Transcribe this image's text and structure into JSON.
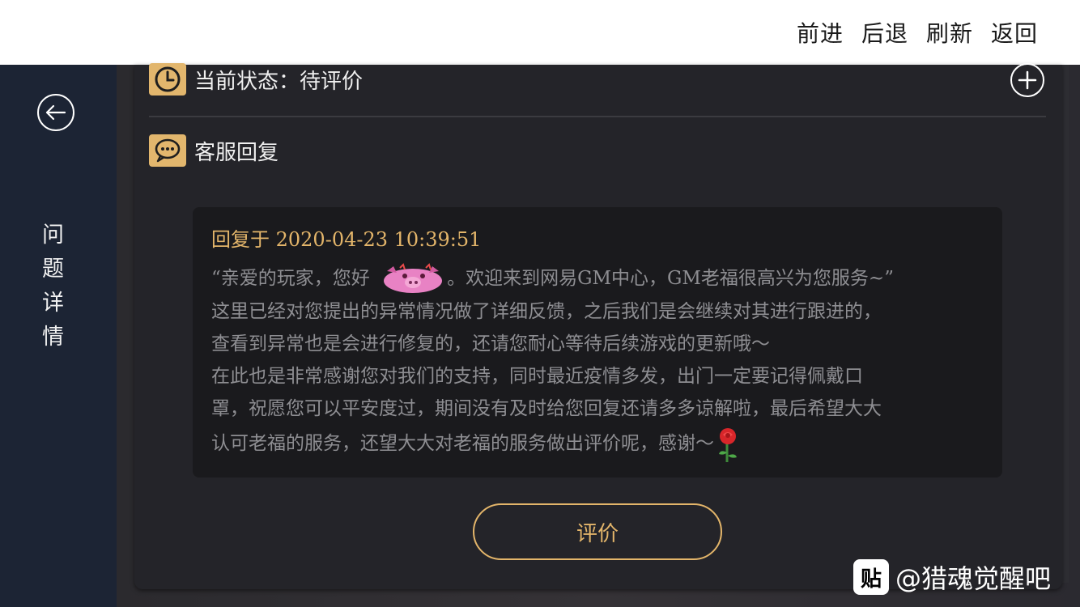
{
  "topbar": {
    "forward": "前进",
    "back": "后退",
    "refresh": "刷新",
    "return": "返回"
  },
  "sidebar": {
    "title_chars": [
      "问",
      "题",
      "详",
      "情"
    ]
  },
  "status": {
    "label": "当前状态：待评价"
  },
  "reply_section": {
    "label": "客服回复",
    "header": "回复于 2020-04-23 10:39:51",
    "line1_a": "“亲爱的玩家，您好",
    "line1_b": "。欢迎来到网易GM中心，GM老福很高兴为您服务~”",
    "line2": "这里已经对您提出的异常情况做了详细反馈，之后我们是会继续对其进行跟进的，",
    "line3": "查看到异常也是会进行修复的，还请您耐心等待后续游戏的更新哦～",
    "line4": "在此也是非常感谢您对我们的支持，同时最近疫情多发，出门一定要记得佩戴口",
    "line5": "罩，祝愿您可以平安度过，期间没有及时给您回复还请多多谅解啦，最后希望大大",
    "line6": "认可老福的服务，还望大大对老福的服务做出评价呢，感谢～"
  },
  "rate_button": {
    "label": "评价"
  },
  "watermark": {
    "icon_text": "贴",
    "text": "@猎魂觉醒吧"
  },
  "colors": {
    "accent": "#e3b56a",
    "sidebar": "#1c2434",
    "panel": "#242429",
    "reply_bg": "#1a1a1d"
  }
}
